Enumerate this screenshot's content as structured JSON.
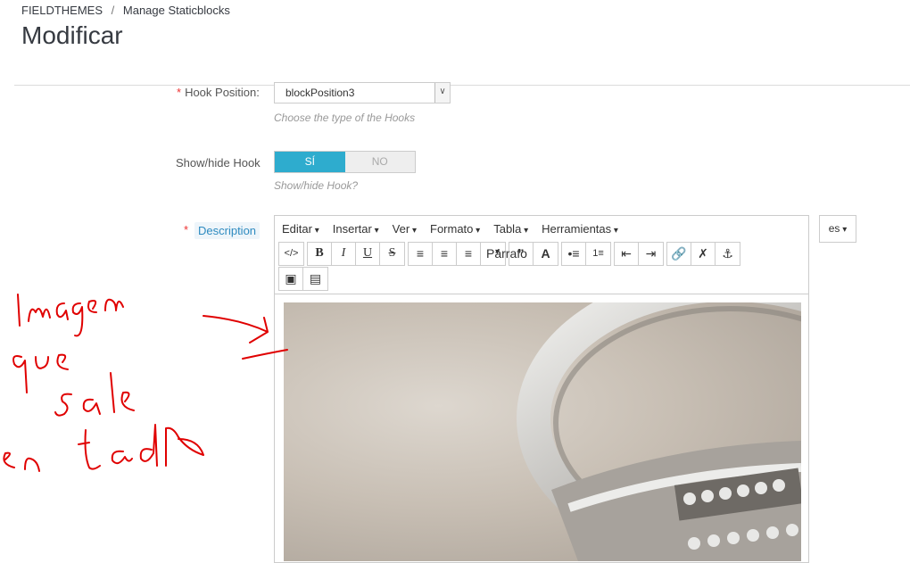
{
  "breadcrumb": {
    "root": "FIELDTHEMES",
    "separator": "/",
    "current": "Manage Staticblocks"
  },
  "page_title": "Modificar",
  "hook_position": {
    "label": "Hook Position:",
    "value": "blockPosition3",
    "help": "Choose the type of the Hooks"
  },
  "show_hide": {
    "label": "Show/hide Hook",
    "yes": "SÍ",
    "no": "NO",
    "help": "Show/hide Hook?"
  },
  "description": {
    "label": "Description",
    "language": "es"
  },
  "editor": {
    "menus": [
      "Editar",
      "Insertar",
      "Ver",
      "Formato",
      "Tabla",
      "Herramientas"
    ],
    "format_select": "Párrafo"
  },
  "colors": {
    "accent": "#2eacce",
    "required": "#ee3333",
    "annotation": "#e00000"
  }
}
